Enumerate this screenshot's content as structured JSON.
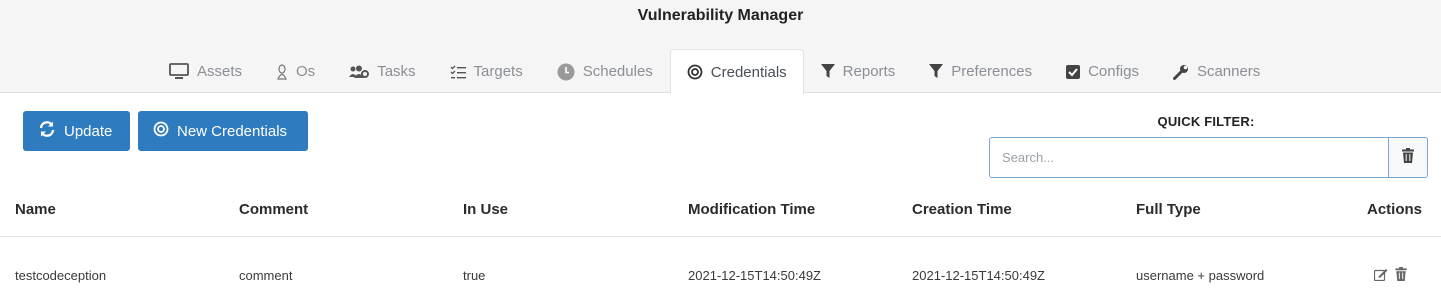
{
  "app": {
    "title": "Vulnerability Manager"
  },
  "tabs": [
    {
      "label": "Assets",
      "icon": "monitor-icon"
    },
    {
      "label": "Os",
      "icon": "linux-icon"
    },
    {
      "label": "Tasks",
      "icon": "users-cog-icon"
    },
    {
      "label": "Targets",
      "icon": "checklist-icon"
    },
    {
      "label": "Schedules",
      "icon": "clock-icon"
    },
    {
      "label": "Credentials",
      "icon": "target-icon",
      "active": true
    },
    {
      "label": "Reports",
      "icon": "filter-icon"
    },
    {
      "label": "Preferences",
      "icon": "filter-icon"
    },
    {
      "label": "Configs",
      "icon": "checkbox-icon"
    },
    {
      "label": "Scanners",
      "icon": "wrench-icon"
    }
  ],
  "toolbar": {
    "update_label": "Update",
    "new_label": "New Credentials"
  },
  "filter": {
    "label": "QUICK FILTER:",
    "placeholder": "Search...",
    "value": ""
  },
  "table": {
    "headers": [
      "Name",
      "Comment",
      "In Use",
      "Modification Time",
      "Creation Time",
      "Full Type",
      "Actions"
    ],
    "rows": [
      {
        "name": "testcodeception",
        "comment": "comment",
        "in_use": "true",
        "modification_time": "2021-12-15T14:50:49Z",
        "creation_time": "2021-12-15T14:50:49Z",
        "full_type": "username + password"
      }
    ]
  },
  "colors": {
    "primary": "#2e7bc0",
    "header_bg": "#f5f5f5",
    "border": "#dee2e6"
  }
}
